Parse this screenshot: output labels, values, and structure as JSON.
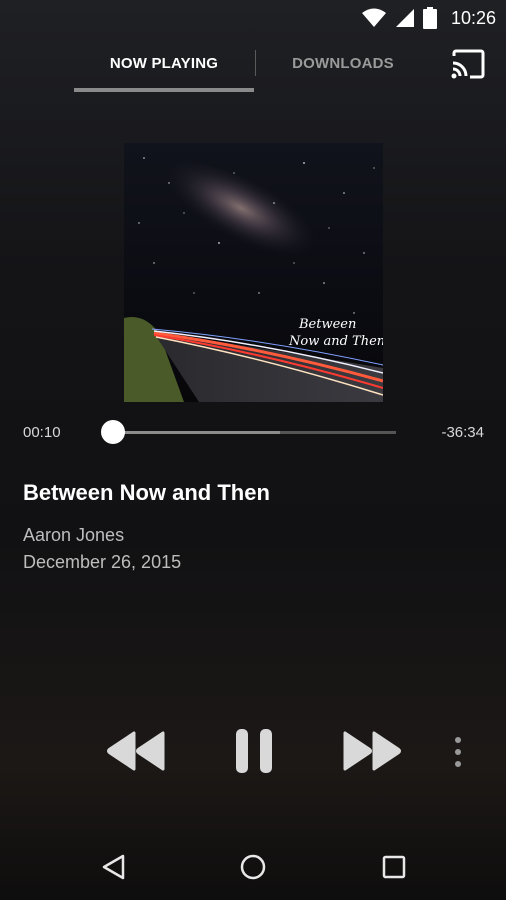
{
  "status_bar": {
    "time": "10:26",
    "icons": [
      "wifi-icon",
      "signal-icon",
      "battery-icon"
    ]
  },
  "tabs": [
    {
      "label": "NOW PLAYING",
      "active": true
    },
    {
      "label": "DOWNLOADS",
      "active": false
    }
  ],
  "cast_icon": "cast-icon",
  "album_art": {
    "text_line1": "Between",
    "text_line2": "Now and Then"
  },
  "progress": {
    "elapsed": "00:10",
    "remaining": "-36:34",
    "played_fraction": 0.005,
    "buffered_fraction": 0.59
  },
  "track": {
    "title": "Between Now and Then",
    "artist": "Aaron Jones",
    "date": "December 26, 2015"
  },
  "controls": [
    "rewind-icon",
    "pause-icon",
    "fast-forward-icon",
    "more-vert-icon"
  ],
  "nav_bar": [
    "back-icon",
    "home-icon",
    "recents-icon"
  ],
  "colors": {
    "background": "#141417",
    "tab_indicator": "#8a8a8a",
    "progress_played": "#ffffff",
    "progress_buffered": "#8c8c8c",
    "progress_track": "#555555"
  }
}
